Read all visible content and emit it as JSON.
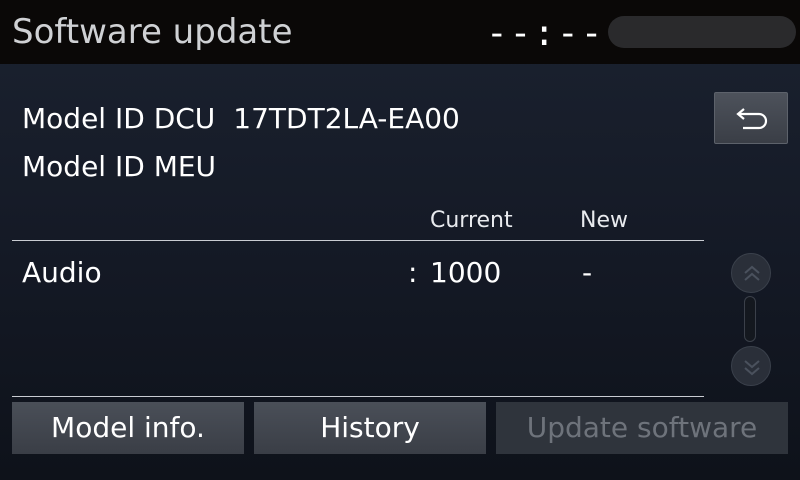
{
  "header": {
    "title": "Software update",
    "clock": "--:--"
  },
  "model": {
    "dcu_label": "Model ID DCU",
    "dcu_value": "17TDT2LA-EA00",
    "meu_label": "Model ID MEU",
    "meu_value": ""
  },
  "table": {
    "col_current": "Current",
    "col_new": "New",
    "rows": [
      {
        "label": "Audio",
        "separator": ":",
        "current": "1000",
        "new": "-"
      }
    ]
  },
  "buttons": {
    "model_info": "Model info.",
    "history": "History",
    "update_software": "Update software",
    "update_software_enabled": false
  },
  "icons": {
    "back": "back-arrow-icon",
    "scroll_up": "double-chevron-up-icon",
    "scroll_down": "double-chevron-down-icon"
  },
  "colors": {
    "header_bg": "#0a0807",
    "disabled_text": "#6e737b"
  }
}
